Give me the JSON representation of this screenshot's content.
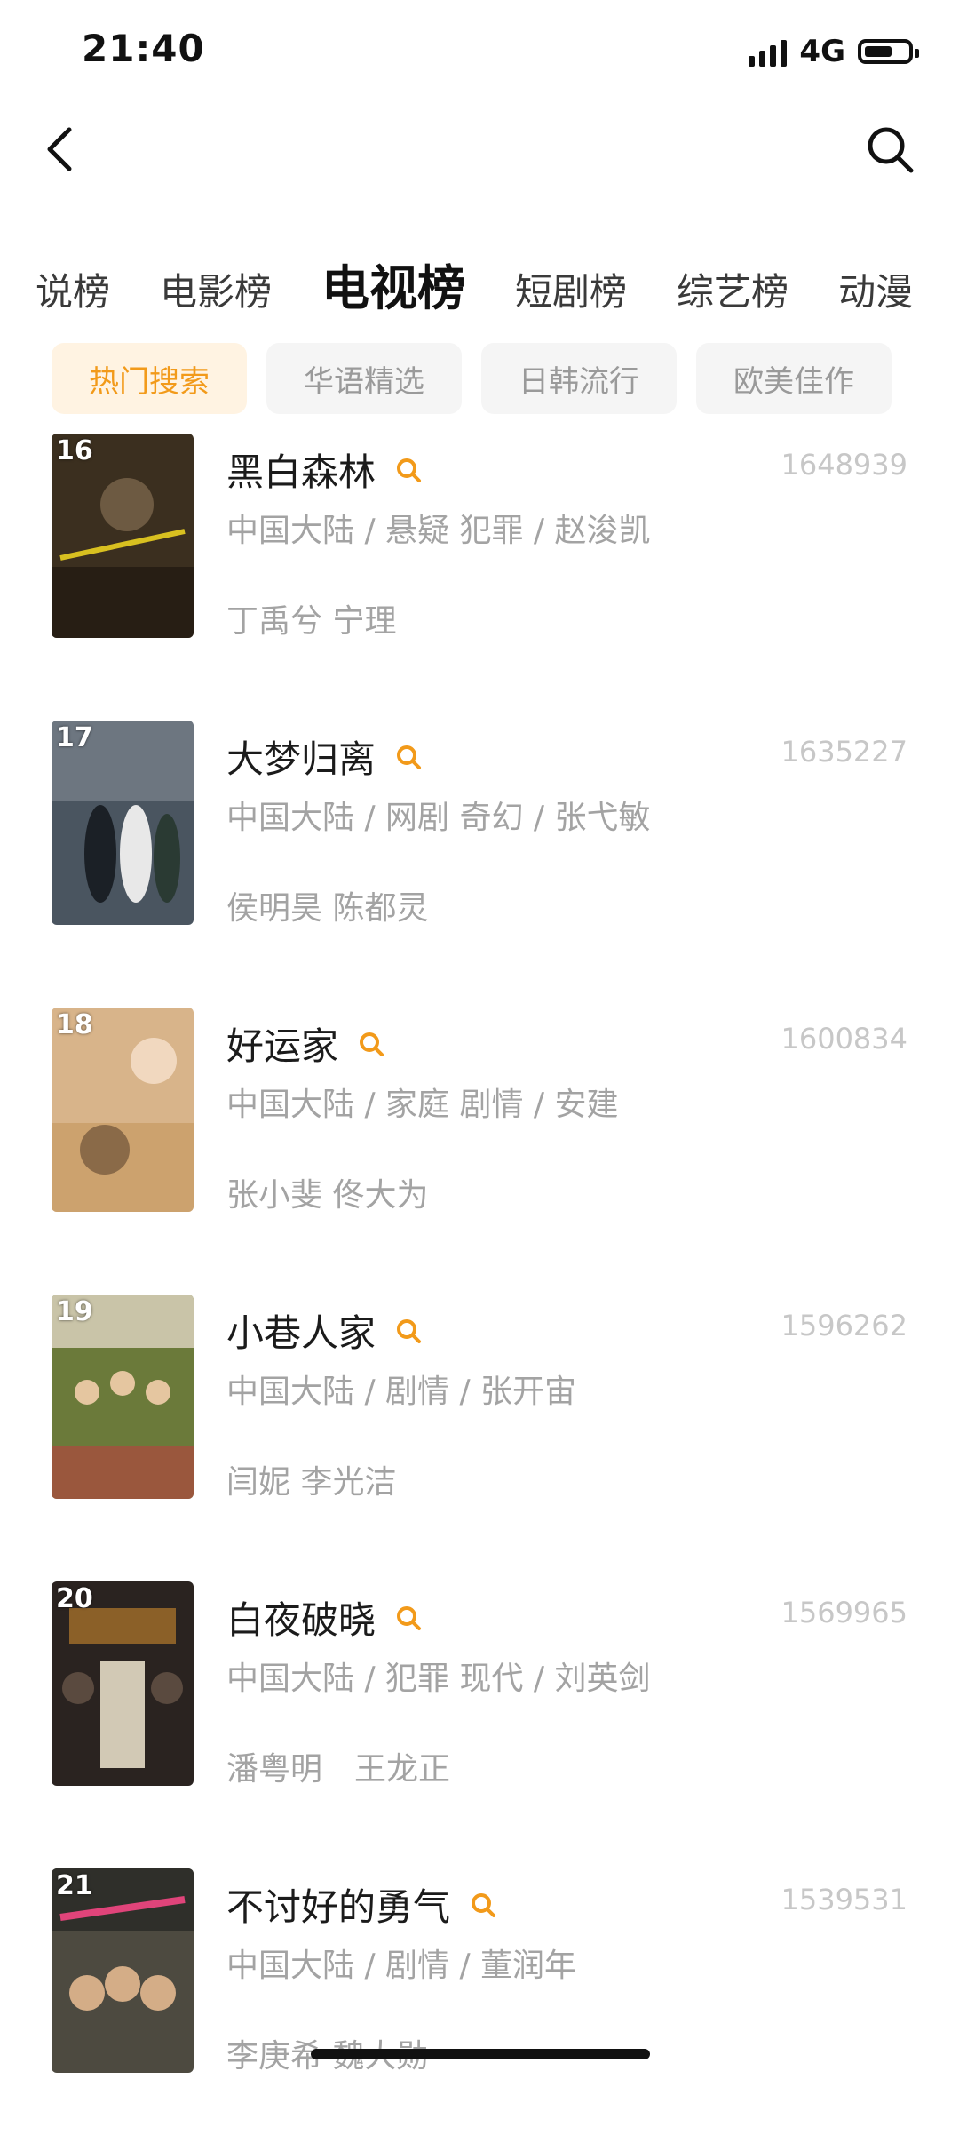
{
  "status_bar": {
    "time": "21:40",
    "network": "4G"
  },
  "nav": {
    "back_icon": "chevron-left-icon",
    "search_icon": "search-icon"
  },
  "tabs": [
    {
      "label": "说榜"
    },
    {
      "label": "电影榜"
    },
    {
      "label": "电视榜",
      "active": true
    },
    {
      "label": "短剧榜"
    },
    {
      "label": "综艺榜"
    },
    {
      "label": "动漫"
    }
  ],
  "filters": [
    {
      "label": "热门搜索",
      "active": true
    },
    {
      "label": "华语精选"
    },
    {
      "label": "日韩流行"
    },
    {
      "label": "欧美佳作"
    }
  ],
  "items": [
    {
      "rank": "16",
      "title": "黑白森林",
      "score": "1648939",
      "meta": "中国大陆 / 悬疑 犯罪 / 赵浚凯",
      "cast": "丁禹兮 宁理",
      "poster_color": "#3b2f1f"
    },
    {
      "rank": "17",
      "title": "大梦归离",
      "score": "1635227",
      "meta": "中国大陆 / 网剧 奇幻 / 张弋敏",
      "cast": "侯明昊 陈都灵",
      "poster_color": "#4a5560"
    },
    {
      "rank": "18",
      "title": "好运家",
      "score": "1600834",
      "meta": "中国大陆 / 家庭 剧情 / 安建",
      "cast": "张小斐 佟大为",
      "poster_color": "#d8b48a"
    },
    {
      "rank": "19",
      "title": "小巷人家",
      "score": "1596262",
      "meta": "中国大陆 / 剧情 / 张开宙",
      "cast": "闫妮 李光洁",
      "poster_color": "#6b7a3a"
    },
    {
      "rank": "20",
      "title": "白夜破晓",
      "score": "1569965",
      "meta": "中国大陆 / 犯罪 现代 / 刘英剑",
      "cast": "潘粤明　王龙正",
      "poster_color": "#2a2320"
    },
    {
      "rank": "21",
      "title": "不讨好的勇气",
      "score": "1539531",
      "meta": "中国大陆 / 剧情 / 董润年",
      "cast": "李庚希 魏大勋",
      "poster_color": "#4d4a40"
    }
  ]
}
